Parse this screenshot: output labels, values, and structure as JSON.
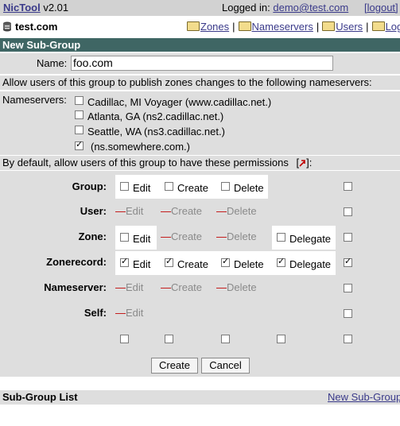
{
  "header": {
    "app_name": "NicTool",
    "version": "v2.01",
    "logged_in_label": "Logged in:",
    "user_email": "demo@test.com",
    "logout_label": "[logout]"
  },
  "nav": {
    "domain": "test.com",
    "links": [
      "Zones",
      "Nameservers",
      "Users",
      "Log"
    ]
  },
  "form": {
    "title": "New Sub-Group",
    "name_label": "Name:",
    "name_value": "foo.com",
    "ns_intro": "Allow users of this group to publish zones changes to the following nameservers:",
    "ns_label": "Nameservers:",
    "nameservers": [
      {
        "label": "Cadillac, MI Voyager (www.cadillac.net.)",
        "checked": false
      },
      {
        "label": "Atlanta, GA (ns2.cadillac.net.)",
        "checked": false
      },
      {
        "label": "Seattle, WA (ns3.cadillac.net.)",
        "checked": false
      },
      {
        "label": "(ns.somewhere.com.)",
        "checked": true
      }
    ],
    "perm_intro_before": "By default, allow users of this group to have these permissions",
    "perm_intro_bracket_open": "[",
    "perm_intro_after": "]:",
    "permissions": {
      "group": {
        "label": "Group:",
        "edit": "Edit",
        "create": "Create",
        "delete": "Delete",
        "edit_checked": false,
        "create_checked": false,
        "delete_checked": false,
        "all_checked": false
      },
      "user": {
        "label": "User:",
        "edit": "Edit",
        "create": "Create",
        "delete": "Delete",
        "all_checked": false
      },
      "zone": {
        "label": "Zone:",
        "edit": "Edit",
        "create": "Create",
        "delete": "Delete",
        "delegate": "Delegate",
        "edit_checked": false,
        "delegate_checked": false,
        "all_checked": false
      },
      "zonerecord": {
        "label": "Zonerecord:",
        "edit": "Edit",
        "create": "Create",
        "delete": "Delete",
        "delegate": "Delegate",
        "edit_checked": true,
        "create_checked": true,
        "delete_checked": true,
        "delegate_checked": true,
        "all_checked": true
      },
      "nameserver": {
        "label": "Nameserver:",
        "edit": "Edit",
        "create": "Create",
        "delete": "Delete",
        "all_checked": false
      },
      "self": {
        "label": "Self:",
        "edit": "Edit",
        "all_checked": false
      }
    },
    "disabled_marker": "—",
    "create_button": "Create",
    "cancel_button": "Cancel"
  },
  "subgroups": {
    "title": "Sub-Group List",
    "new_link": "New Sub-Group"
  },
  "colors": {
    "title_bar": "#3f6664",
    "gray_row": "#dedede",
    "link": "#3a3a8a"
  }
}
